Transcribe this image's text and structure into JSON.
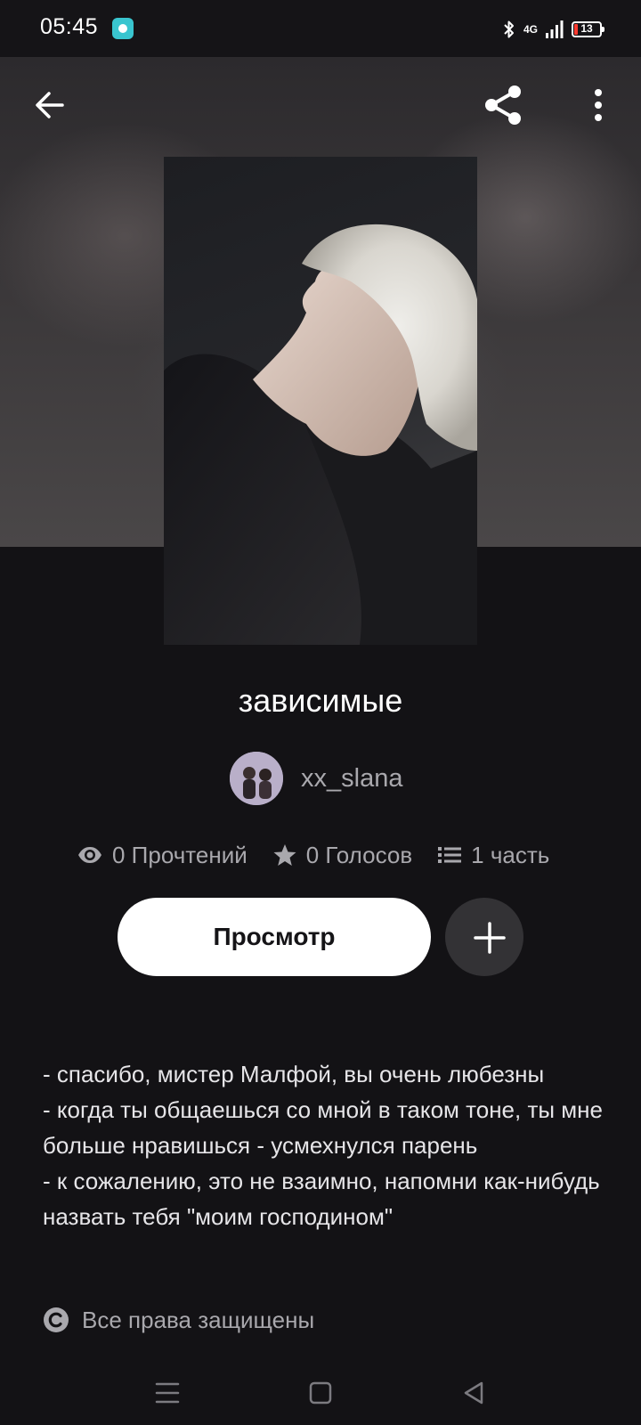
{
  "status_bar": {
    "time": "05:45",
    "network": "4G",
    "battery": "13"
  },
  "icons": {
    "back": "arrow-left-icon",
    "share": "share-icon",
    "more": "more-vertical-icon",
    "reads": "eye-icon",
    "votes": "star-icon",
    "parts": "list-icon",
    "add": "plus-icon",
    "copyright": "copyright-icon"
  },
  "story": {
    "title": "зависимые",
    "author": "xx_slana",
    "stats": {
      "reads": "0 Прочтений",
      "votes": "0 Голосов",
      "parts": "1 часть"
    },
    "view_label": "Просмотр",
    "description": "- спасибо, мистер Малфой, вы очень любезны\n- когда ты общаешься со мной в таком тоне, ты мне больше нравишься - усмехнулся парень\n- к сожалению, это не взаимно, напомни как-нибудь назвать тебя \"моим господином\"",
    "copyright": "Все права защищены"
  },
  "colors": {
    "background": "#131215",
    "muted_text": "#a9a8ad",
    "primary_button": "#ffffff",
    "secondary_button": "#333235"
  }
}
